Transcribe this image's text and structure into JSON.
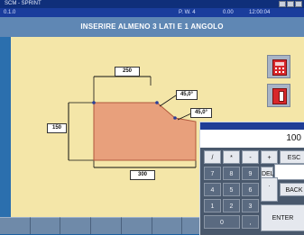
{
  "titlebar": {
    "title": "SCM - SPRINT"
  },
  "status": {
    "left": "0.1.0",
    "program": "P. W. 4",
    "value": "0.00",
    "time": "12:00:04"
  },
  "instruction": "INSERIRE ALMENO 3 LATI E 1 ANGOLO",
  "drawing": {
    "top_width": "250",
    "bottom_width": "300",
    "left_height": "150",
    "angle1": "45,0°",
    "angle2": "45,0°",
    "shape_color": "#e8a07c"
  },
  "keypad": {
    "display": "100",
    "keys": {
      "divide": "/",
      "multiply": "*",
      "minus": "-",
      "plus": "+",
      "esc": "ESC",
      "del": "DEL",
      "seven": "7",
      "eight": "8",
      "nine": "9",
      "dot": ".",
      "back": "BACK",
      "four": "4",
      "five": "5",
      "six": "6",
      "one": "1",
      "two": "2",
      "three": "3",
      "enter": "ENTER",
      "zero": "0",
      "comma": ","
    }
  }
}
